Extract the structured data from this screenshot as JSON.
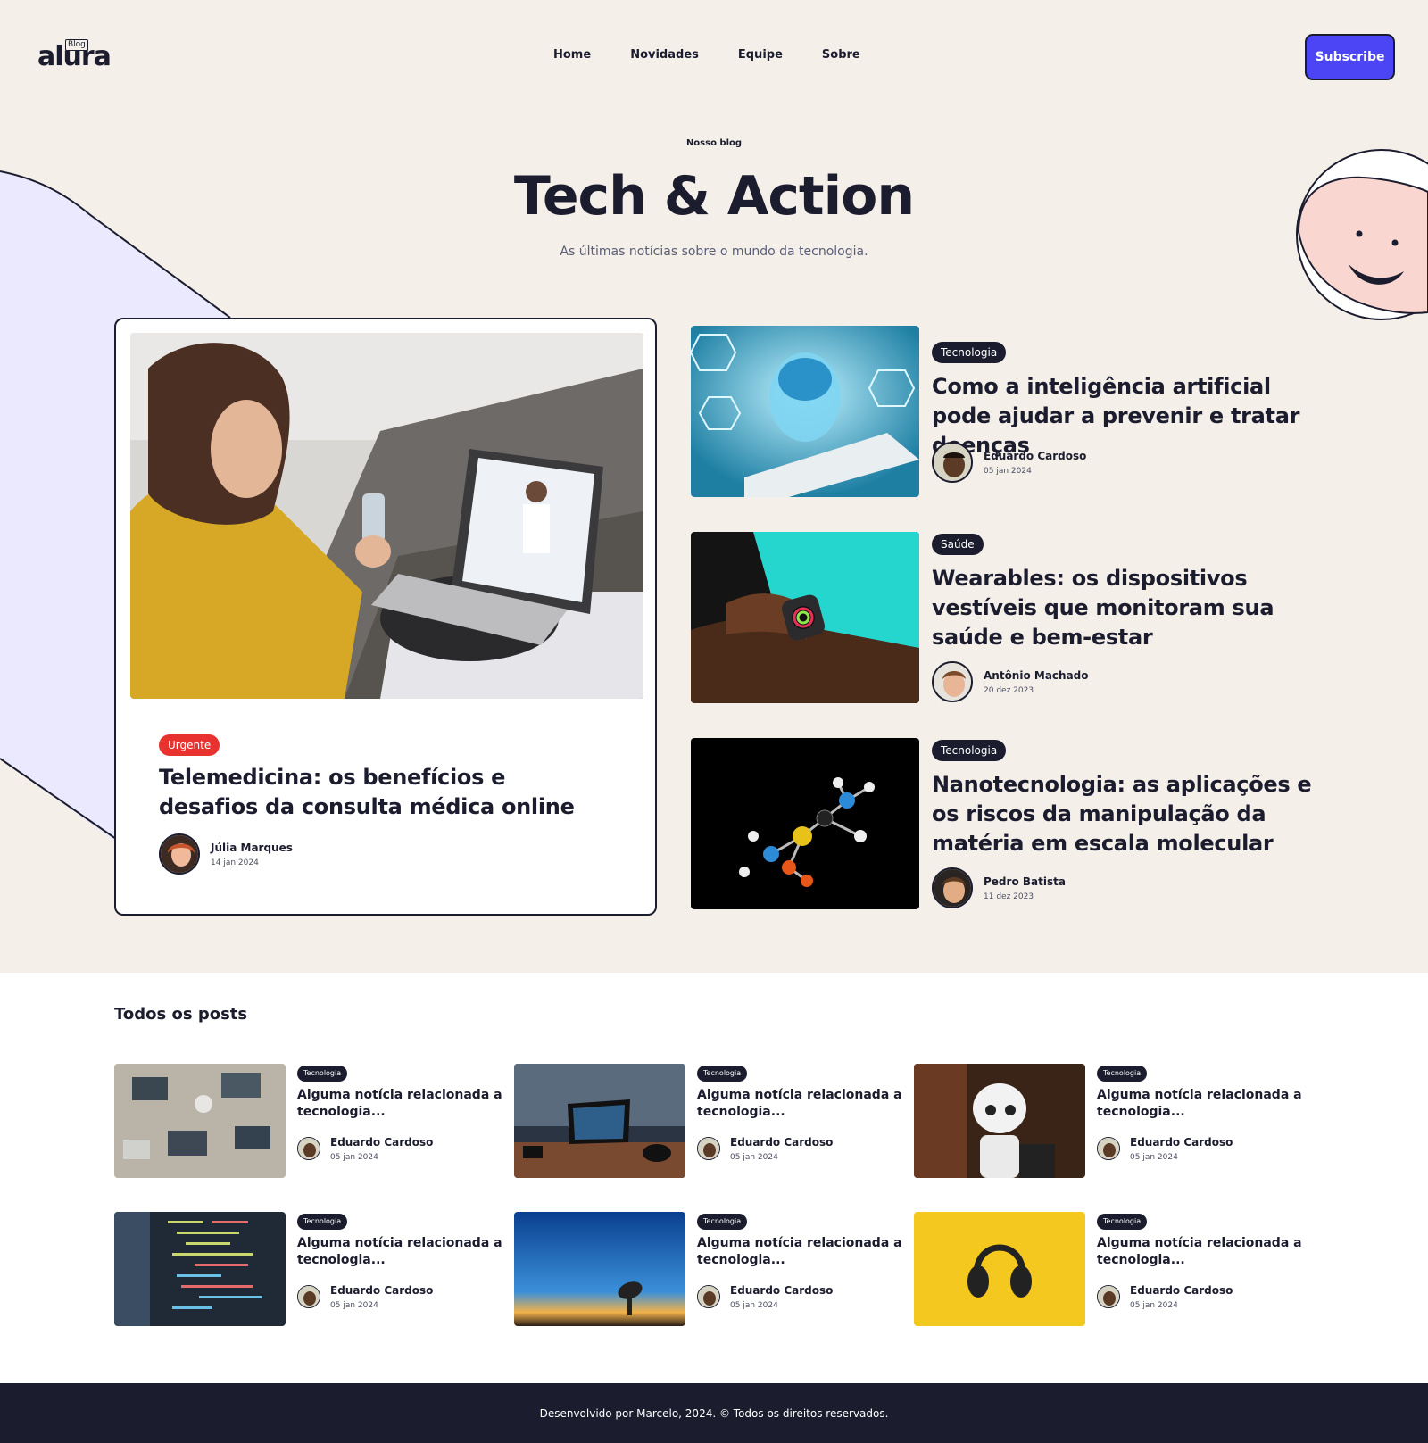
{
  "brand": {
    "name": "alura",
    "tag": "Blog"
  },
  "nav": {
    "items": [
      "Home",
      "Novidades",
      "Equipe",
      "Sobre"
    ],
    "subscribe": "Subscribe"
  },
  "hero": {
    "eyebrow": "Nosso blog",
    "title": "Tech & Action",
    "subtitle": "As últimas notícias sobre o mundo da tecnologia."
  },
  "featured": {
    "badge": "Urgente",
    "title": "Telemedicina: os benefícios e desafios da consulta médica online",
    "author": "Júlia Marques",
    "date": "14 jan 2024"
  },
  "side_posts": [
    {
      "badge": "Tecnologia",
      "title": "Como a inteligência artificial pode ajudar a prevenir e tratar doenças",
      "author": "Eduardo Cardoso",
      "date": "05 jan 2024"
    },
    {
      "badge": "Saúde",
      "title": "Wearables: os dispositivos vestíveis que monitoram sua saúde e bem-estar",
      "author": "Antônio Machado",
      "date": "20 dez 2023"
    },
    {
      "badge": "Tecnologia",
      "title": "Nanotecnologia: as aplicações e os riscos da manipulação da matéria em escala molecular",
      "author": "Pedro Batista",
      "date": "11 dez 2023"
    }
  ],
  "all_posts": {
    "heading": "Todos os posts",
    "items": [
      {
        "badge": "Tecnologia",
        "title": "Alguma notícia relacionada a tecnologia...",
        "author": "Eduardo Cardoso",
        "date": "05 jan 2024"
      },
      {
        "badge": "Tecnologia",
        "title": "Alguma notícia relacionada a tecnologia...",
        "author": "Eduardo Cardoso",
        "date": "05 jan 2024"
      },
      {
        "badge": "Tecnologia",
        "title": "Alguma notícia relacionada a tecnologia...",
        "author": "Eduardo Cardoso",
        "date": "05 jan 2024"
      },
      {
        "badge": "Tecnologia",
        "title": "Alguma notícia relacionada a tecnologia...",
        "author": "Eduardo Cardoso",
        "date": "05 jan 2024"
      },
      {
        "badge": "Tecnologia",
        "title": "Alguma notícia relacionada a tecnologia...",
        "author": "Eduardo Cardoso",
        "date": "05 jan 2024"
      },
      {
        "badge": "Tecnologia",
        "title": "Alguma notícia relacionada a tecnologia...",
        "author": "Eduardo Cardoso",
        "date": "05 jan 2024"
      }
    ]
  },
  "footer": {
    "text": "Desenvolvido por Marcelo, 2024. © Todos os direitos reservados."
  },
  "colors": {
    "background": "#f4efe9",
    "accent": "#4b45f5",
    "dark": "#1b1c2e",
    "urgent": "#e8322f",
    "decor_lilac": "#ebe9fd",
    "face": "#f9d6d0"
  }
}
